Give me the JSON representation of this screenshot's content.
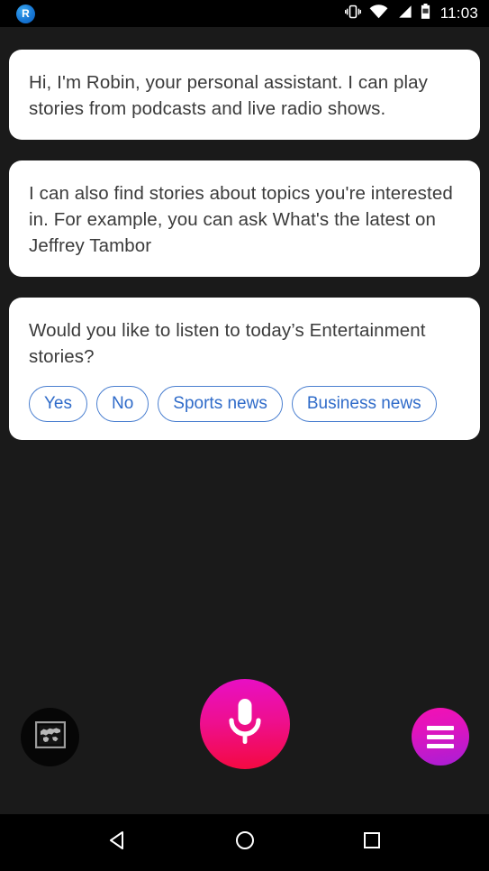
{
  "status_bar": {
    "app_badge_letter": "R",
    "app_badge_icon": "robin-app-icon",
    "vibrate_icon": "vibrate-icon",
    "wifi_icon": "wifi-icon",
    "cellular_icon": "cellular-signal-icon",
    "battery_icon": "battery-icon",
    "time": "11:03"
  },
  "conversation": {
    "messages": [
      {
        "text": "Hi, I'm Robin, your personal assistant. I can play stories from podcasts and live radio shows."
      },
      {
        "text": "I can also find stories about topics you're interested in. For example, you can ask What's the latest on Jeffrey Tambor"
      },
      {
        "text": "Would you like to listen to today’s Entertainment stories?",
        "chips": [
          "Yes",
          "No",
          "Sports news",
          "Business news"
        ]
      }
    ]
  },
  "action_bar": {
    "map_button_icon": "world-map-icon",
    "mic_button_icon": "microphone-icon",
    "menu_button_icon": "hamburger-menu-icon"
  },
  "nav_bar": {
    "back_icon": "back-triangle-icon",
    "home_icon": "home-circle-icon",
    "recents_icon": "recents-square-icon"
  },
  "colors": {
    "background": "#1a1a1a",
    "status_bar": "#000000",
    "bubble": "#ffffff",
    "bubble_text": "#3b3b3b",
    "chip_border": "#4a7fd0",
    "chip_text": "#2f6bc9",
    "mic_gradient_start": "#e80fc6",
    "mic_gradient_end": "#f4093f",
    "menu_gradient_start": "#f411b4",
    "menu_gradient_end": "#a81ed6"
  }
}
